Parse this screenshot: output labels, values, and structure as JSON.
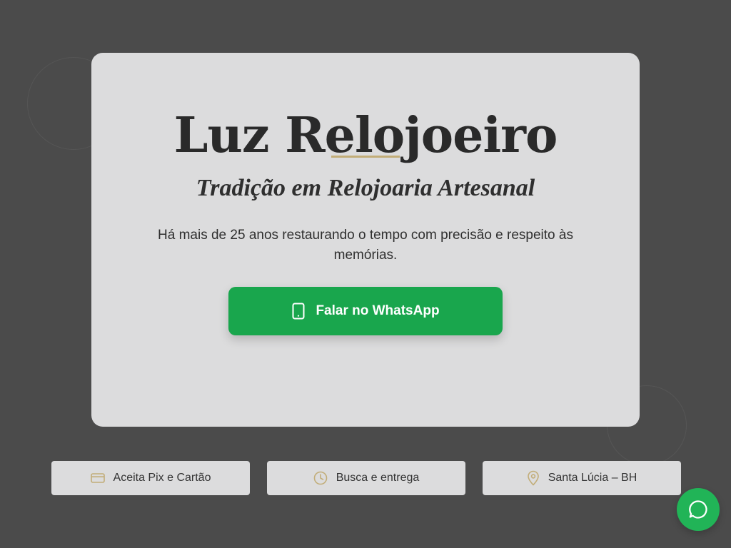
{
  "colors": {
    "page_background": "#4b4b4b",
    "card_background": "#dcdcdd",
    "accent_gold": "#c2ad78",
    "whatsapp_green": "#19a64d",
    "text_dark": "#2a2a2a"
  },
  "hero": {
    "title": "Luz Relojoeiro",
    "subtitle": "Tradição em Relojoaria Artesanal",
    "description": "Há mais de 25 anos restaurando o tempo com precisão e respeito às memórias.",
    "cta": {
      "label": "Falar no WhatsApp",
      "icon": "smartphone-icon"
    }
  },
  "badges": [
    {
      "label": "Aceita Pix e Cartão",
      "icon": "credit-card-icon"
    },
    {
      "label": "Busca e entrega",
      "icon": "clock-icon"
    },
    {
      "label": "Santa Lúcia – BH",
      "icon": "map-pin-icon"
    }
  ],
  "floating_button": {
    "icon": "chat-bubble-icon"
  }
}
